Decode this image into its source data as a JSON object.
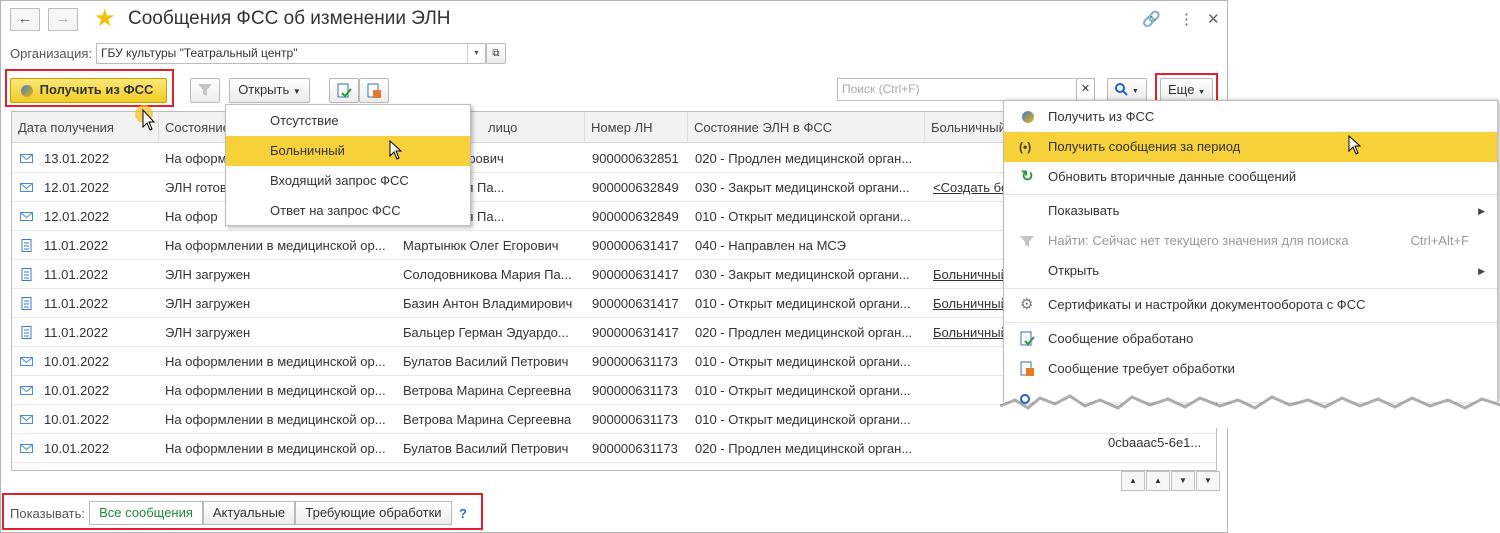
{
  "window": {
    "title": "Сообщения ФСС об изменении ЭЛН"
  },
  "filter": {
    "org_label": "Организация:",
    "org_value": "ГБУ культуры \"Театральный центр\""
  },
  "toolbar": {
    "get_fss": "Получить из ФСС",
    "open": "Открыть",
    "search_placeholder": "Поиск (Ctrl+F)",
    "more": "Еще"
  },
  "open_menu": [
    "Отсутствие",
    "Больничный",
    "Входящий запрос ФСС",
    "Ответ на запрос ФСС"
  ],
  "columns": [
    "Дата получения",
    "Состояние",
    "лицо",
    "Номер ЛН",
    "Состояние ЭЛН в ФСС",
    "Больничный"
  ],
  "rows": [
    {
      "date": "13.01.2022",
      "state": "На оформл",
      "person": "н Владимирович",
      "ln": "900000632851",
      "fss": "020 - Продлен медицинской орган...",
      "sick": ""
    },
    {
      "date": "12.01.2022",
      "state": "ЭЛН готов",
      "person": "кова Мария Па...",
      "ln": "900000632849",
      "fss": "030 - Закрыт медицинской органи...",
      "sick": "<Создать бо"
    },
    {
      "date": "12.01.2022",
      "state": "На офор",
      "person": "кова Мария Па...",
      "ln": "900000632849",
      "fss": "010 - Открыт медицинской органи...",
      "sick": ""
    },
    {
      "date": "11.01.2022",
      "state": "На оформлении в медицинской ор...",
      "person": "Мартынюк Олег Егорович",
      "ln": "900000631417",
      "fss": "040 - Направлен на МСЭ",
      "sick": ""
    },
    {
      "date": "11.01.2022",
      "state": "ЭЛН загружен",
      "person": "Солодовникова Мария Па...",
      "ln": "900000631417",
      "fss": "030 - Закрыт медицинской органи...",
      "sick": "Больничный"
    },
    {
      "date": "11.01.2022",
      "state": "ЭЛН загружен",
      "person": "Базин Антон Владимирович",
      "ln": "900000631417",
      "fss": "010 - Открыт медицинской органи...",
      "sick": "Больничный"
    },
    {
      "date": "11.01.2022",
      "state": "ЭЛН загружен",
      "person": "Бальцер Герман Эдуардо...",
      "ln": "900000631417",
      "fss": "020 - Продлен медицинской орган...",
      "sick": "Больничный"
    },
    {
      "date": "10.01.2022",
      "state": "На оформлении в медицинской ор...",
      "person": "Булатов Василий Петрович",
      "ln": "900000631173",
      "fss": "010 - Открыт медицинской органи...",
      "sick": ""
    },
    {
      "date": "10.01.2022",
      "state": "На оформлении в медицинской ор...",
      "person": "Ветрова Марина Сергеевна",
      "ln": "900000631173",
      "fss": "010 - Открыт медицинской органи...",
      "sick": ""
    },
    {
      "date": "10.01.2022",
      "state": "На оформлении в медицинской ор...",
      "person": "Ветрова Марина Сергеевна",
      "ln": "900000631173",
      "fss": "010 - Открыт медицинской органи...",
      "sick": ""
    },
    {
      "date": "10.01.2022",
      "state": "На оформлении в медицинской ор...",
      "person": "Булатов Василий Петрович",
      "ln": "900000631173",
      "fss": "020 - Продлен медицинской орган...",
      "sick": ""
    }
  ],
  "row_icons": [
    "envelope-icon",
    "envelope-icon",
    "envelope-icon",
    "document-icon",
    "document-icon",
    "document-icon",
    "document-icon",
    "envelope-icon",
    "envelope-icon",
    "envelope-icon",
    "envelope-icon"
  ],
  "right_fragments": [
    "0cbaaac5-6e1..."
  ],
  "more_menu": [
    {
      "label": "Получить из ФСС",
      "icon": "fss-icon",
      "shortcut": "",
      "disabled": false,
      "submenu": false
    },
    {
      "label": "Получить сообщения за период",
      "icon": "radio-signal-icon",
      "shortcut": "",
      "disabled": false,
      "submenu": false
    },
    {
      "label": "Обновить вторичные данные сообщений",
      "icon": "refresh-icon",
      "shortcut": "",
      "disabled": false,
      "submenu": false
    },
    {
      "label": "Показывать",
      "icon": "",
      "shortcut": "",
      "disabled": false,
      "submenu": true
    },
    {
      "label": "Найти: Сейчас нет текущего значения для поиска",
      "icon": "find-icon",
      "shortcut": "Ctrl+Alt+F",
      "disabled": true,
      "submenu": false
    },
    {
      "label": "Открыть",
      "icon": "",
      "shortcut": "",
      "disabled": false,
      "submenu": true
    },
    {
      "label": "Сертификаты и настройки документооборота с ФСС",
      "icon": "gear-icon",
      "shortcut": "",
      "disabled": false,
      "submenu": false
    },
    {
      "label": "Сообщение обработано",
      "icon": "check-doc-icon",
      "shortcut": "",
      "disabled": false,
      "submenu": false
    },
    {
      "label": "Сообщение требует обработки",
      "icon": "pending-doc-icon",
      "shortcut": "",
      "disabled": false,
      "submenu": false
    }
  ],
  "bottom": {
    "show_label": "Показывать:",
    "tabs": [
      "Все сообщения",
      "Актуальные",
      "Требующие обработки"
    ],
    "help": "?"
  },
  "colors": {
    "accent": "#f7d139",
    "red_frame": "#e3202b",
    "active_tab": "#1a8a3a"
  }
}
